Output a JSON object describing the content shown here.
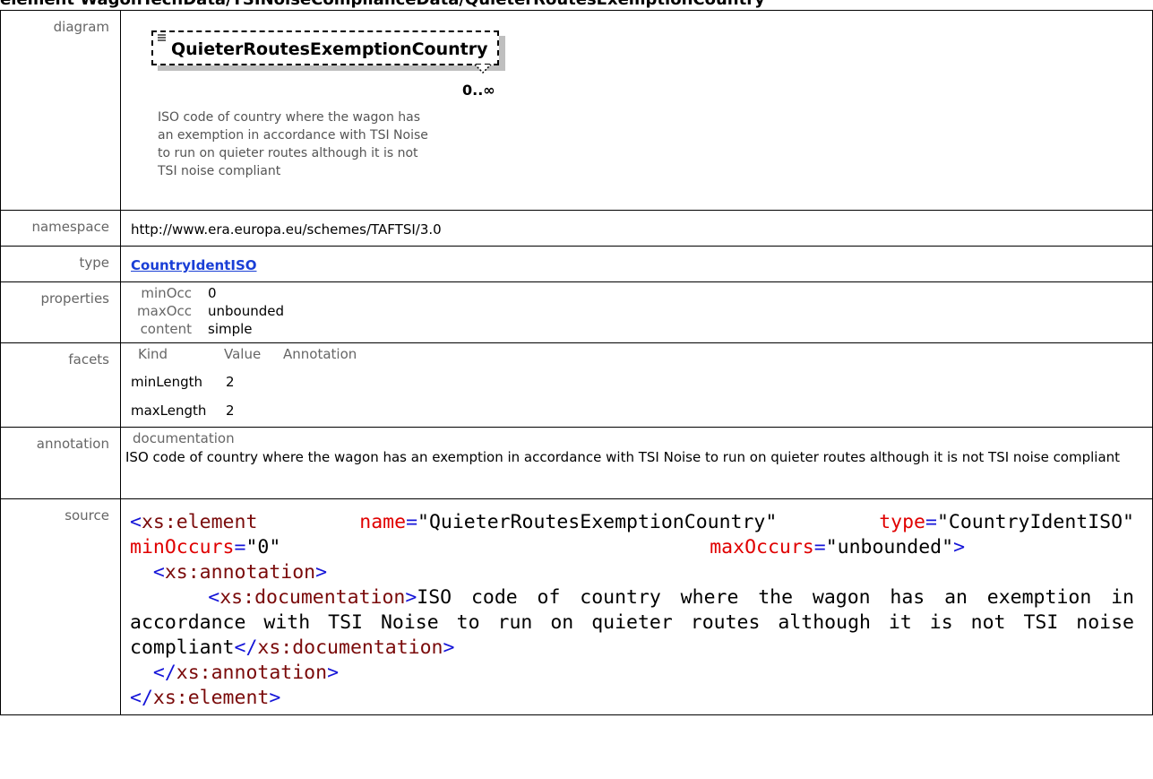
{
  "heading": "element WagonTechData/TSINoiseComplianceData/QuieterRoutesExemptionCountry",
  "rows": {
    "diagram": {
      "key": "diagram",
      "element_name": "QuieterRoutesExemptionCountry",
      "occurrence": "0..∞",
      "doc_lines": [
        "ISO code of country where the wagon has",
        "an exemption in accordance with TSI Noise",
        "to run on quieter routes although it is not",
        "TSI noise compliant"
      ],
      "icon": "sequence-lines-icon"
    },
    "namespace": {
      "key": "namespace",
      "value": "http://www.era.europa.eu/schemes/TAFTSI/3.0"
    },
    "type": {
      "key": "type",
      "value": "CountryIdentISO"
    },
    "properties": {
      "key": "properties",
      "items": [
        {
          "k": "minOcc",
          "v": "0"
        },
        {
          "k": "maxOcc",
          "v": "unbounded"
        },
        {
          "k": "content",
          "v": "simple"
        }
      ]
    },
    "facets": {
      "key": "facets",
      "headers": [
        "Kind",
        "Value",
        "Annotation"
      ],
      "items": [
        {
          "kind": "minLength",
          "value": "2"
        },
        {
          "kind": "maxLength",
          "value": "2"
        }
      ]
    },
    "annotation": {
      "key": "annotation",
      "label": "documentation",
      "text": "ISO code of country where the wagon has an exemption in accordance with TSI Noise to run on quieter routes although it is not TSI noise compliant"
    },
    "source": {
      "key": "source",
      "el_open": "xs:element",
      "attr_name": "name",
      "attr_name_val": "\"QuieterRoutesExemptionCountry\"",
      "attr_type": "type",
      "attr_type_val": "\"CountryIdentISO\"",
      "attr_min": "minOccurs",
      "attr_min_val": "\"0\"",
      "attr_max": "maxOccurs",
      "attr_max_val": "\"unbounded\"",
      "anno_tag": "xs:annotation",
      "doc_tag": "xs:documentation",
      "doc_text": "ISO code of country where the wagon has an exemption in accordance with TSI Noise to run on quieter routes although it is not TSI noise",
      "doc_text_end": "compliant"
    }
  }
}
